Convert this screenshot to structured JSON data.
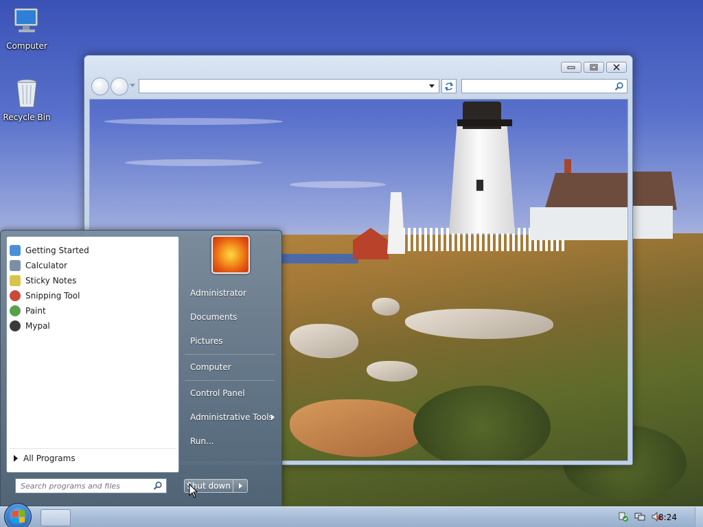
{
  "desktop": {
    "icons": [
      {
        "label": "Computer"
      },
      {
        "label": "Recycle Bin"
      }
    ]
  },
  "browser": {
    "address_value": "",
    "search_value": "",
    "icons": {
      "back": "back-icon",
      "forward": "forward-icon",
      "refresh": "refresh-icon",
      "search": "search-icon",
      "minimize": "minimize-icon",
      "restore": "restore-icon",
      "close": "close-icon"
    }
  },
  "start_menu": {
    "programs": [
      {
        "label": "Getting Started",
        "color": "#4a90d9"
      },
      {
        "label": "Calculator",
        "color": "#7a8fa8"
      },
      {
        "label": "Sticky Notes",
        "color": "#d8c44a"
      },
      {
        "label": "Snipping Tool",
        "color": "#c84a3a"
      },
      {
        "label": "Paint",
        "color": "#5aa04a"
      },
      {
        "label": "Mypal",
        "color": "#3a3a3a"
      }
    ],
    "all_programs": "All Programs",
    "search_placeholder": "Search programs and files",
    "right_items": {
      "administrator": "Administrator",
      "documents": "Documents",
      "pictures": "Pictures",
      "computer": "Computer",
      "control_panel": "Control Panel",
      "administrative_tools": "Administrative Tools",
      "run": "Run..."
    },
    "shutdown_label": "Shut down"
  },
  "taskbar": {
    "clock": "8:24"
  }
}
